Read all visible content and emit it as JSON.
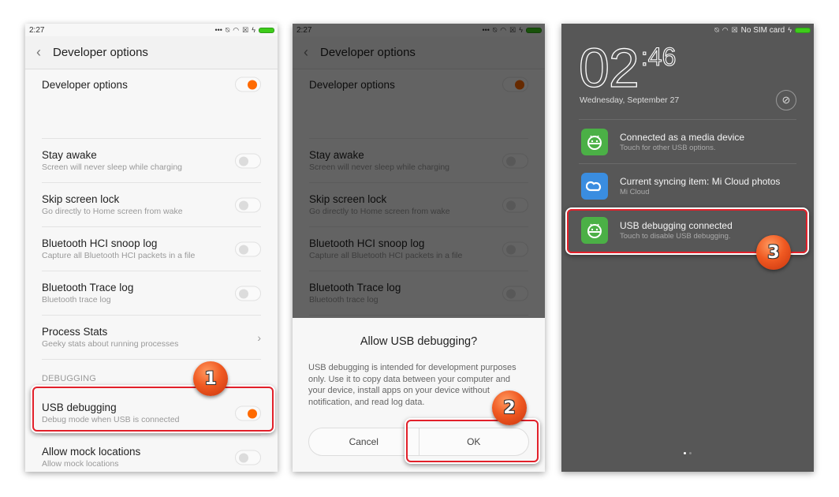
{
  "panel1": {
    "status": {
      "time": "2:27"
    },
    "header": {
      "back_icon": "chevron-left-icon",
      "title": "Developer options"
    },
    "master_toggle": {
      "label": "Developer options",
      "on": true
    },
    "items": [
      {
        "label": "Stay awake",
        "sub": "Screen will never sleep while charging",
        "control": "toggle",
        "on": false
      },
      {
        "label": "Skip screen lock",
        "sub": "Go directly to Home screen from wake",
        "control": "toggle",
        "on": false
      },
      {
        "label": "Bluetooth HCI snoop log",
        "sub": "Capture all Bluetooth HCI packets in a file",
        "control": "toggle",
        "on": false
      },
      {
        "label": "Bluetooth Trace log",
        "sub": "Bluetooth trace log",
        "control": "toggle",
        "on": false
      },
      {
        "label": "Process Stats",
        "sub": "Geeky stats about running processes",
        "control": "chevron"
      }
    ],
    "section_label": "DEBUGGING",
    "debug_items": [
      {
        "label": "USB debugging",
        "sub": "Debug mode when USB is connected",
        "on": true
      },
      {
        "label": "Allow mock locations",
        "sub": "Allow mock locations",
        "on": false
      }
    ],
    "step_badge": "1"
  },
  "panel2": {
    "status": {
      "time": "2:27"
    },
    "header": {
      "title": "Developer options"
    },
    "master_toggle": {
      "label": "Developer options"
    },
    "items": [
      {
        "label": "Stay awake",
        "sub": "Screen will never sleep while charging"
      },
      {
        "label": "Skip screen lock",
        "sub": "Go directly to Home screen from wake"
      },
      {
        "label": "Bluetooth HCI snoop log",
        "sub": "Capture all Bluetooth HCI packets in a file"
      },
      {
        "label": "Bluetooth Trace log",
        "sub": "Bluetooth trace log"
      }
    ],
    "dialog": {
      "title": "Allow USB debugging?",
      "body": "USB debugging is intended for development purposes only. Use it to copy data between your computer and your device, install apps on your device without notification, and read log data.",
      "cancel_label": "Cancel",
      "ok_label": "OK"
    },
    "step_badge": "2"
  },
  "panel3": {
    "status": {
      "carrier": "No SIM card"
    },
    "clock": {
      "hours": "02",
      "minutes": "46"
    },
    "date": "Wednesday, September 27",
    "notifications": [
      {
        "icon": "android-icon",
        "title": "Connected as a media device",
        "sub": "Touch for other USB options."
      },
      {
        "icon": "cloud-icon",
        "title": "Current syncing item: Mi Cloud photos",
        "sub": "Mi Cloud"
      },
      {
        "icon": "android-icon",
        "title": "USB debugging connected",
        "sub": "Touch to disable USB debugging."
      }
    ],
    "page_indicator": {
      "pages": 2,
      "current": 1
    },
    "step_badge": "3"
  }
}
